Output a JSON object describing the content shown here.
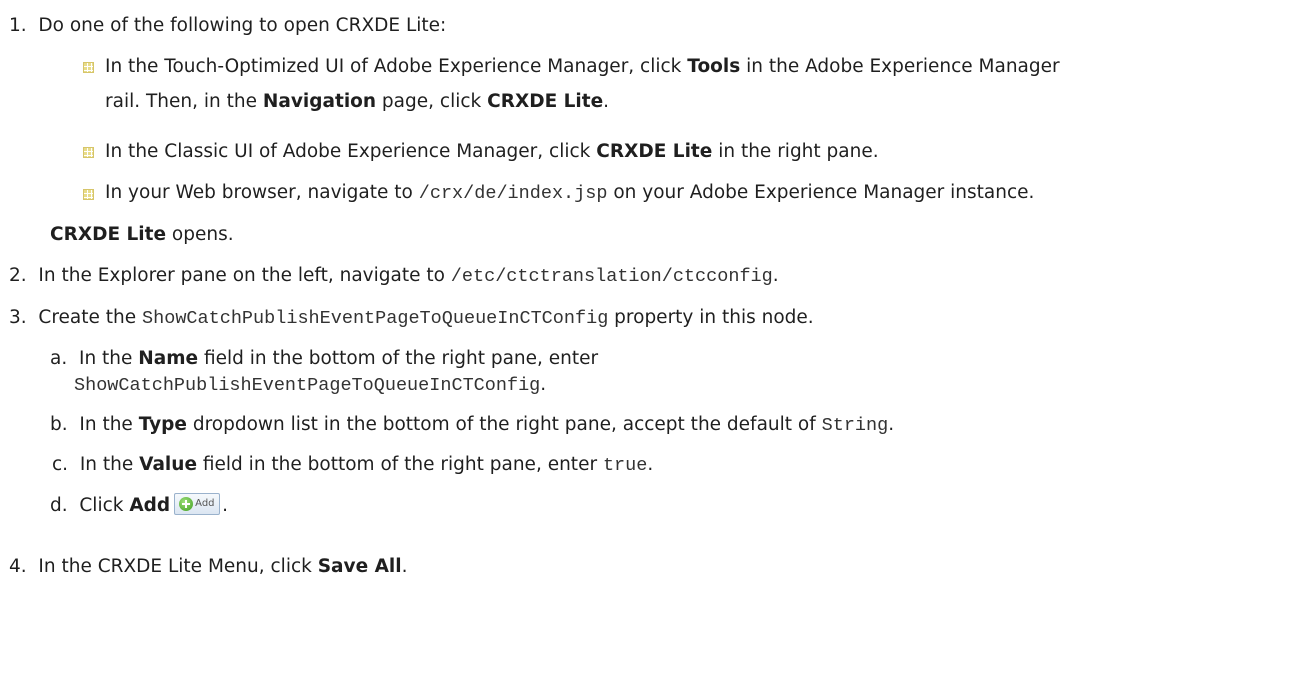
{
  "steps": {
    "s1": {
      "num": "1.",
      "text": "Do one of the following to open CRXDE Lite:"
    },
    "b1": {
      "l1_a": "In the Touch-Optimized UI of Adobe Experience Manager, click ",
      "l1_tools": "Tools",
      "l1_b": " in the Adobe Experience Manager",
      "l2_a": "rail. Then, in the ",
      "l2_nav": "Navigation",
      "l2_b": " page, click ",
      "l2_crx": "CRXDE Lite",
      "l2_c": "."
    },
    "b2": {
      "a": "In the Classic UI of Adobe Experience Manager, click ",
      "crx": "CRXDE Lite",
      "b": " in the right pane."
    },
    "b3": {
      "a": "In your Web browser, navigate to ",
      "code": "/crx/de/index.jsp",
      "b": " on your Adobe Experience Manager instance."
    },
    "opens": {
      "bold": "CRXDE Lite",
      "rest": " opens."
    },
    "s2": {
      "num": "2.",
      "a": "In the Explorer pane on the left, navigate to ",
      "code": "/etc/ctctranslation/ctcconfig",
      "b": "."
    },
    "s3": {
      "num": "3.",
      "a": "Create the ",
      "code": "ShowCatchPublishEventPageToQueueInCTConfig",
      "b": " property in this node."
    },
    "sa": {
      "letter": "a.",
      "a": "In the ",
      "bold": "Name",
      "b": " field in the bottom of the right pane, enter",
      "code": "ShowCatchPublishEventPageToQueueInCTConfig",
      "c": "."
    },
    "sb": {
      "letter": "b.",
      "a": "In the ",
      "bold": "Type",
      "b": " dropdown list in the bottom of the right pane, accept the default of ",
      "code": "String",
      "c": "."
    },
    "sc": {
      "letter": "c.",
      "a": "In the ",
      "bold": "Value",
      "b": " field in the bottom of the right pane, enter ",
      "code": "true",
      "c": "."
    },
    "sd": {
      "letter": "d.",
      "a": "Click ",
      "bold": "Add",
      "btn": "Add",
      "c": "."
    },
    "s4": {
      "num": "4.",
      "a": "In the CRXDE Lite Menu, click ",
      "bold": "Save All",
      "b": "."
    }
  },
  "icons": {
    "bullet": "square-grid-bullet-icon",
    "add": "add-plus-icon"
  },
  "colors": {
    "bullet": "#e8dc8a",
    "add_icon": "#3f9e1f",
    "text": "#1f1f1f"
  }
}
